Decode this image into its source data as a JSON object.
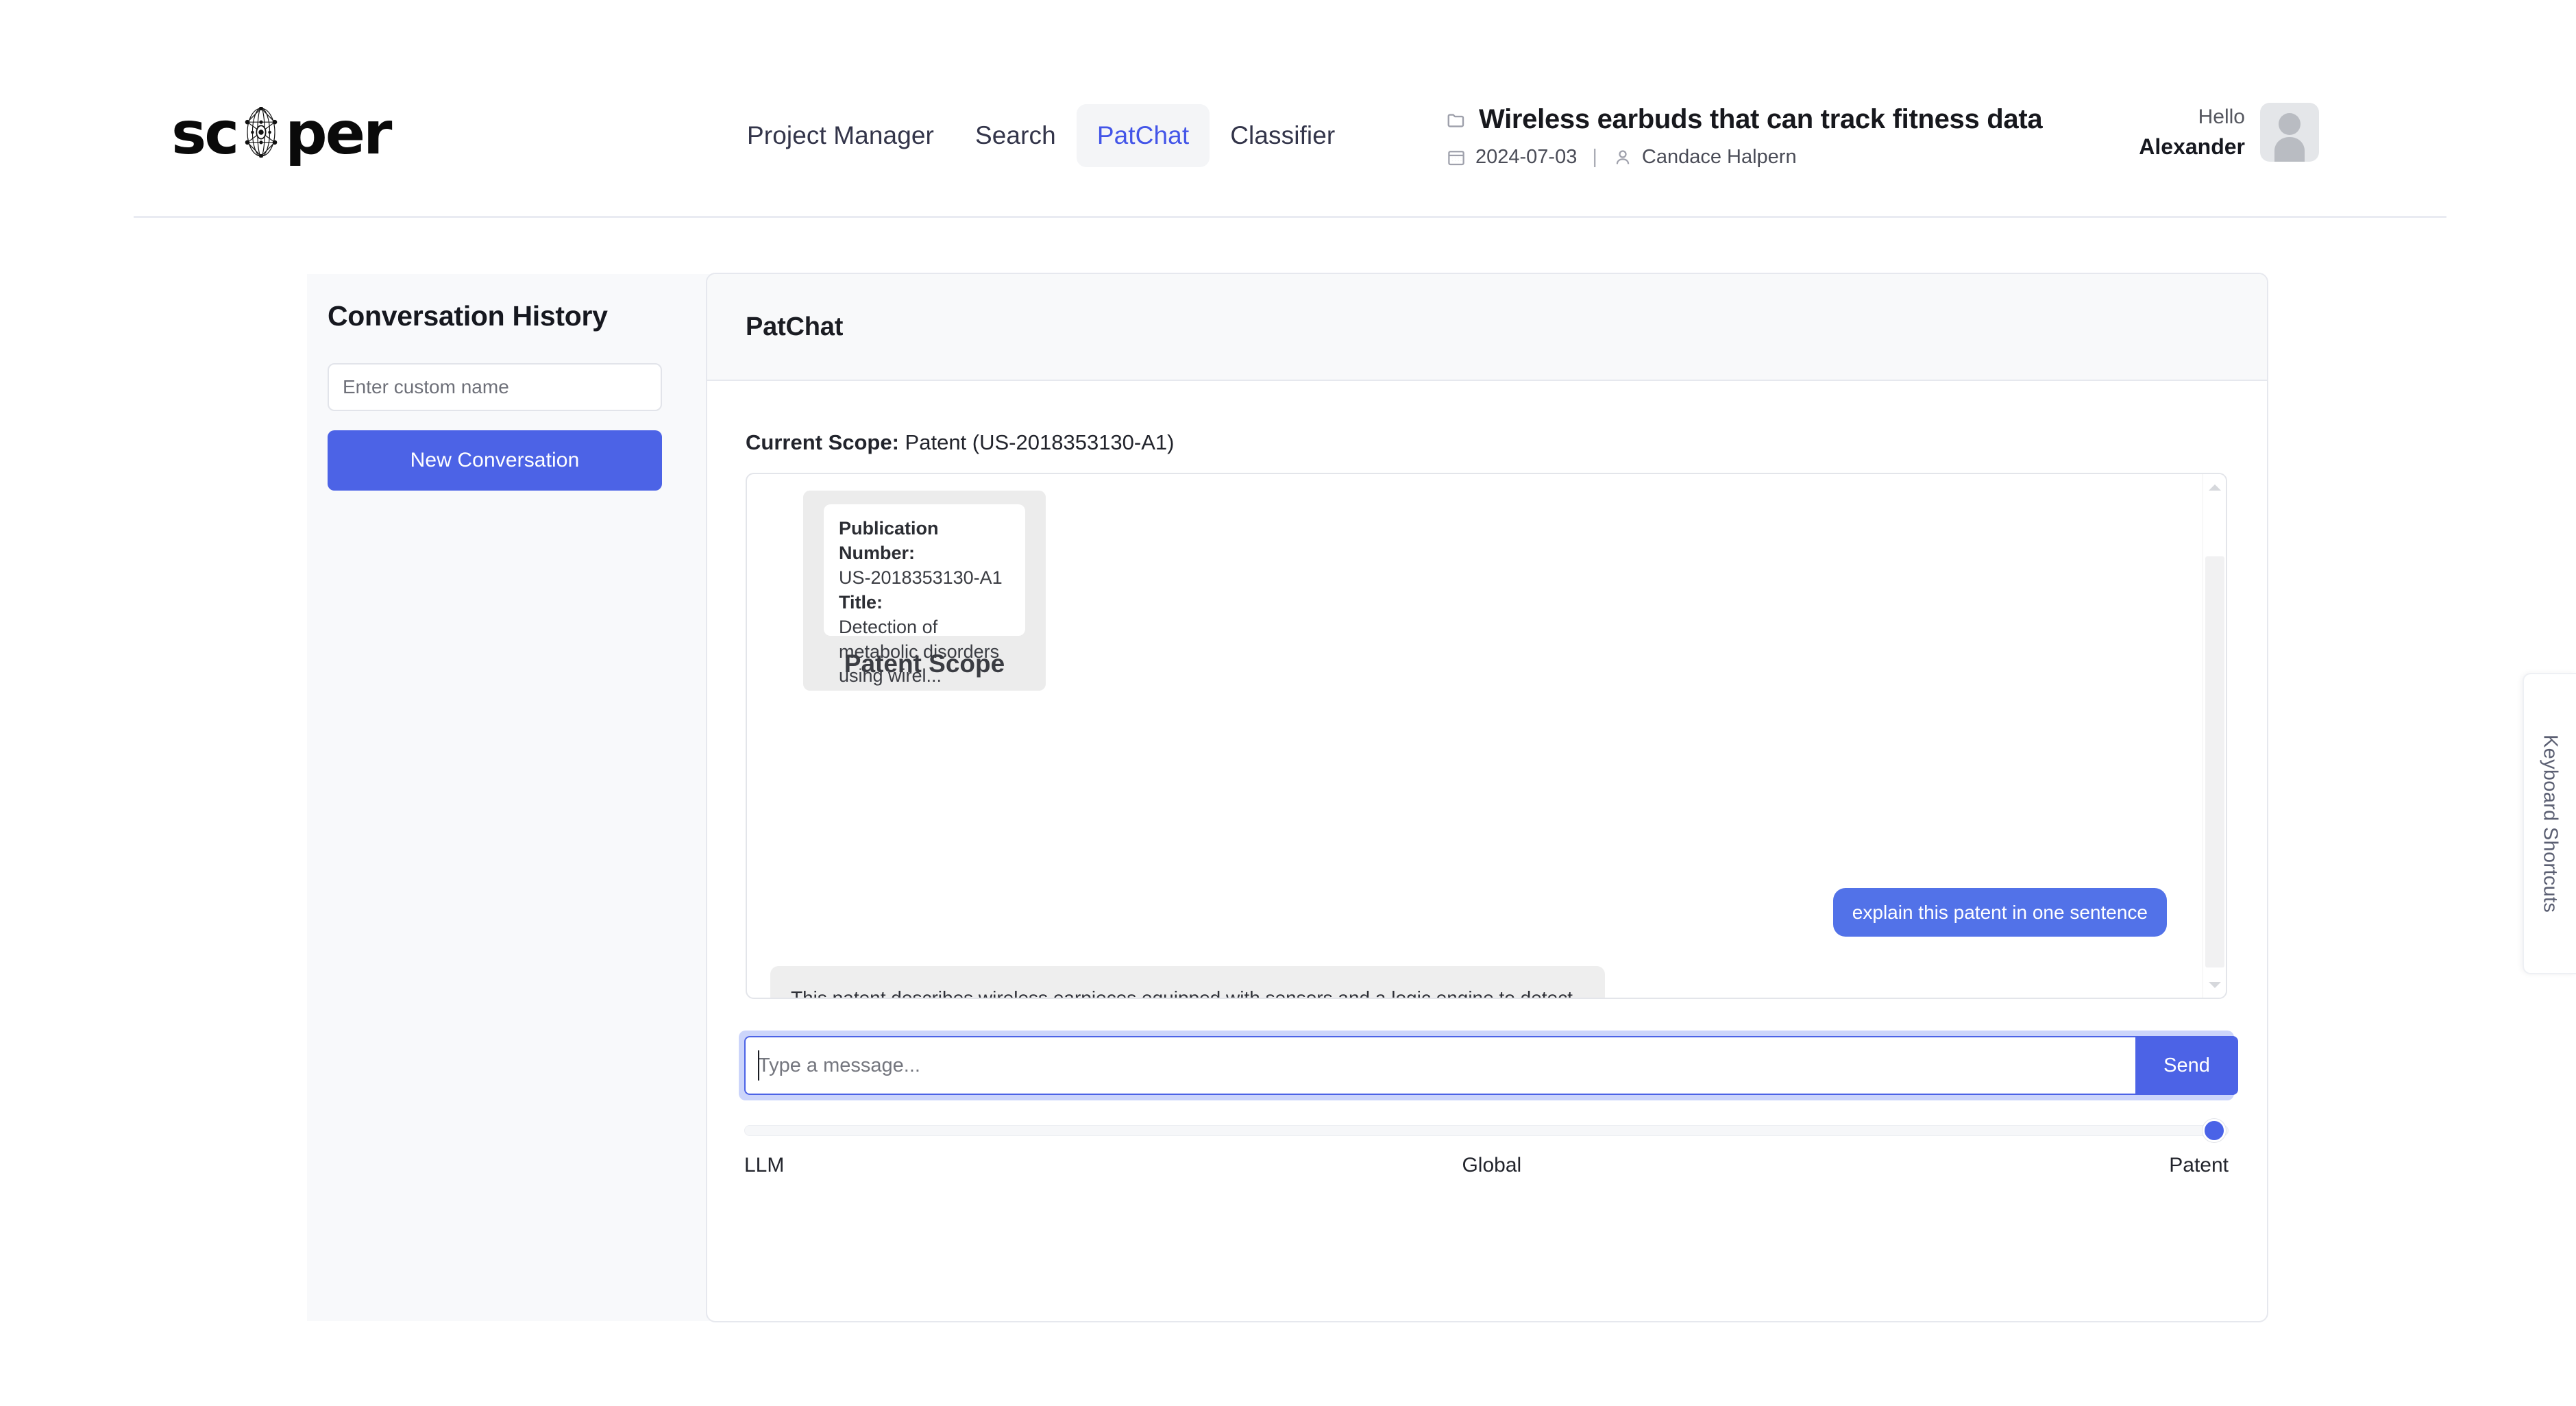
{
  "brand": {
    "logo_text_before": "sc",
    "logo_text_after": "per",
    "logo_icon": "network-eye-icon"
  },
  "nav": {
    "items": [
      {
        "label": "Project Manager",
        "active": false
      },
      {
        "label": "Search",
        "active": false
      },
      {
        "label": "PatChat",
        "active": true
      },
      {
        "label": "Classifier",
        "active": false
      }
    ]
  },
  "project": {
    "title": "Wireless earbuds that can track fitness data",
    "date": "2024-07-03",
    "separator": "|",
    "owner": "Candace Halpern",
    "folder_icon": "folder-icon",
    "calendar_icon": "calendar-icon",
    "person_icon": "person-icon"
  },
  "user": {
    "greeting": "Hello",
    "name": "Alexander",
    "avatar_icon": "user-avatar-icon"
  },
  "sidebar": {
    "title": "Conversation History",
    "name_input_placeholder": "Enter custom name",
    "name_input_value": "",
    "new_conversation_label": "New Conversation"
  },
  "main": {
    "card_title": "PatChat",
    "scope_label": "Current Scope:",
    "scope_value": "Patent (US-2018353130-A1)",
    "scope_card": {
      "publication_number_label": "Publication Number:",
      "publication_number": "US-2018353130-A1",
      "title_label": "Title:",
      "title_value": "Detection of metabolic disorders using wirel...",
      "card_label": "Patent Scope"
    },
    "messages": [
      {
        "role": "user",
        "text": "explain this patent in one sentence"
      },
      {
        "role": "assistant",
        "text": "This patent describes wireless earpieces equipped with sensors and a logic engine to detect metabolic disorders and monitor user biometrics, providing alerts based on changes in the user's status."
      }
    ],
    "composer": {
      "placeholder": "Type a message...",
      "value": "",
      "send_label": "Send"
    },
    "scope_slider": {
      "labels": [
        "LLM",
        "Global",
        "Patent"
      ],
      "selected": "Patent",
      "position_percent": 100
    }
  },
  "keyboard_shortcuts": {
    "label": "Keyboard Shortcuts"
  },
  "colors": {
    "accent_blue": "#4c63e6",
    "user_bubble_blue": "#5272e8",
    "nav_active_blue": "#4355e8",
    "bot_bubble_gray": "#eeeeee",
    "panel_gray": "#f8f9fb"
  }
}
